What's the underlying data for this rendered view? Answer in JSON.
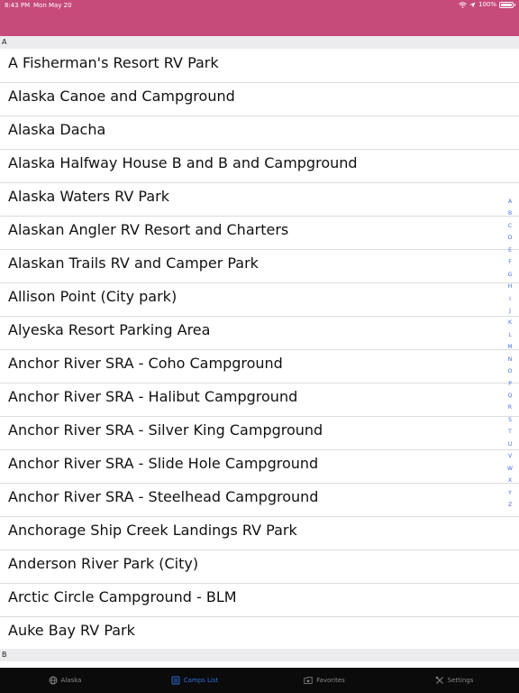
{
  "status": {
    "time": "8:43 PM",
    "date": "Mon May 20",
    "battery": "100%"
  },
  "sections": [
    {
      "letter": "A",
      "items": [
        "A Fisherman's Resort RV Park",
        "Alaska Canoe and Campground",
        "Alaska Dacha",
        "Alaska Halfway House B and B and Campground",
        "Alaska Waters RV Park",
        "Alaskan Angler RV Resort and Charters",
        "Alaskan Trails RV and Camper Park",
        "Allison Point (City park)",
        "Alyeska Resort Parking Area",
        "Anchor River SRA - Coho Campground",
        "Anchor River SRA - Halibut Campground",
        "Anchor River SRA - Silver King Campground",
        "Anchor River SRA - Slide Hole Campground",
        "Anchor River SRA - Steelhead Campground",
        "Anchorage Ship Creek Landings RV Park",
        "Anderson River Park (City)",
        "Arctic Circle Campground - BLM",
        "Auke Bay RV Park"
      ]
    },
    {
      "letter": "B",
      "items": []
    }
  ],
  "index_letters": [
    "A",
    "B",
    "C",
    "D",
    "E",
    "F",
    "G",
    "H",
    "I",
    "J",
    "K",
    "L",
    "M",
    "N",
    "O",
    "P",
    "Q",
    "R",
    "S",
    "T",
    "U",
    "V",
    "W",
    "X",
    "Y",
    "Z"
  ],
  "tabs": [
    {
      "label": "Alaska",
      "icon": "globe-icon",
      "active": false
    },
    {
      "label": "Camps List",
      "icon": "list-icon",
      "active": true
    },
    {
      "label": "Favorites",
      "icon": "star-folder-icon",
      "active": false
    },
    {
      "label": "Settings",
      "icon": "tools-icon",
      "active": false
    }
  ],
  "colors": {
    "status_bar": "#c64a7a",
    "accent": "#2f6fe4",
    "tab_bar": "#0b0b0b"
  }
}
